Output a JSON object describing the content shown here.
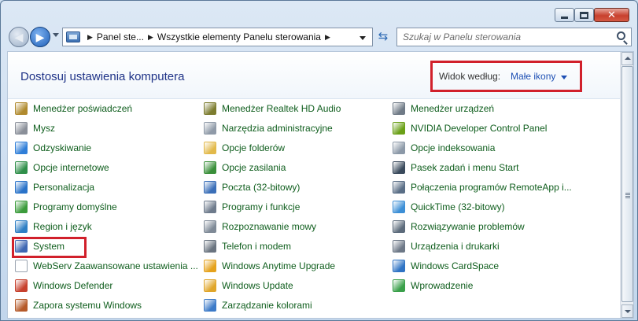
{
  "window": {
    "title": "",
    "controls": [
      "minimize-icon",
      "maximize-icon",
      "close-icon"
    ]
  },
  "nav": {
    "breadcrumbs": [
      "Panel ste...",
      "Wszystkie elementy Panelu sterowania"
    ],
    "search_placeholder": "Szukaj w Panelu sterowania"
  },
  "header": {
    "title": "Dostosuj ustawienia komputera",
    "view_by_label": "Widok według:",
    "view_by_value": "Małe ikony"
  },
  "items": {
    "col1": [
      {
        "label": "Menedżer poświadczeń",
        "icon": "credential-manager-icon",
        "color": "#b08a2e"
      },
      {
        "label": "Mysz",
        "icon": "mouse-icon",
        "color": "#8a8f99"
      },
      {
        "label": "Odzyskiwanie",
        "icon": "recovery-icon",
        "color": "#2f7ed8"
      },
      {
        "label": "Opcje internetowe",
        "icon": "internet-options-icon",
        "color": "#2f8f4a"
      },
      {
        "label": "Personalizacja",
        "icon": "personalization-icon",
        "color": "#2a73c9"
      },
      {
        "label": "Programy domyślne",
        "icon": "default-programs-icon",
        "color": "#3b9b3b"
      },
      {
        "label": "Region i język",
        "icon": "region-icon",
        "color": "#2e7fc4"
      },
      {
        "label": "System",
        "icon": "system-icon",
        "color": "#3f67b3"
      },
      {
        "label": "WebServ Zaawansowane ustawienia ...",
        "icon": "webserv-icon",
        "color": "#ffffff"
      },
      {
        "label": "Windows Defender",
        "icon": "windows-defender-icon",
        "color": "#c7412e"
      },
      {
        "label": "Zapora systemu Windows",
        "icon": "firewall-icon",
        "color": "#b55a2a"
      }
    ],
    "col2": [
      {
        "label": "Menedżer Realtek HD Audio",
        "icon": "realtek-audio-icon",
        "color": "#7c7c2f"
      },
      {
        "label": "Narzędzia administracyjne",
        "icon": "admin-tools-icon",
        "color": "#8f9aa8"
      },
      {
        "label": "Opcje folderów",
        "icon": "folder-options-icon",
        "color": "#e2b94a"
      },
      {
        "label": "Opcje zasilania",
        "icon": "power-options-icon",
        "color": "#3a8f3a"
      },
      {
        "label": "Poczta (32-bitowy)",
        "icon": "mail-icon",
        "color": "#3b6fb8"
      },
      {
        "label": "Programy i funkcje",
        "icon": "programs-features-icon",
        "color": "#6e7b8c"
      },
      {
        "label": "Rozpoznawanie mowy",
        "icon": "speech-recognition-icon",
        "color": "#7f8a97"
      },
      {
        "label": "Telefon i modem",
        "icon": "phone-modem-icon",
        "color": "#6a7480"
      },
      {
        "label": "Windows Anytime Upgrade",
        "icon": "anytime-upgrade-icon",
        "color": "#e5a21c"
      },
      {
        "label": "Windows Update",
        "icon": "windows-update-icon",
        "color": "#e0a62a"
      },
      {
        "label": "Zarządzanie kolorami",
        "icon": "color-management-icon",
        "color": "#3c7ac8"
      }
    ],
    "col3": [
      {
        "label": "Menedżer urządzeń",
        "icon": "device-manager-icon",
        "color": "#6f7a86"
      },
      {
        "label": "NVIDIA Developer Control Panel",
        "icon": "nvidia-icon",
        "color": "#6aa017"
      },
      {
        "label": "Opcje indeksowania",
        "icon": "indexing-options-icon",
        "color": "#8c99a8"
      },
      {
        "label": "Pasek zadań i menu Start",
        "icon": "taskbar-icon",
        "color": "#3a4a5c"
      },
      {
        "label": "Połączenia programów RemoteApp i...",
        "icon": "remoteapp-icon",
        "color": "#5a6e86"
      },
      {
        "label": "QuickTime (32-bitowy)",
        "icon": "quicktime-icon",
        "color": "#3d8fd6"
      },
      {
        "label": "Rozwiązywanie problemów",
        "icon": "troubleshooting-icon",
        "color": "#5c6b7b"
      },
      {
        "label": "Urządzenia i drukarki",
        "icon": "devices-printers-icon",
        "color": "#6d7887"
      },
      {
        "label": "Windows CardSpace",
        "icon": "cardspace-icon",
        "color": "#2f73c4"
      },
      {
        "label": "Wprowadzenie",
        "icon": "getting-started-icon",
        "color": "#3aa04a"
      }
    ]
  },
  "highlight_color": "#d1202b"
}
